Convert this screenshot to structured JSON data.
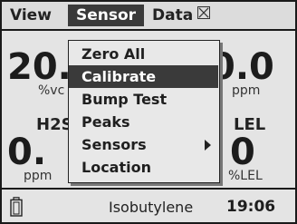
{
  "menubar": {
    "items": [
      "View",
      "Sensor",
      "Data"
    ],
    "close_icon": "close-box-icon"
  },
  "readings": {
    "r1": {
      "value": "20.",
      "unit": "%vc"
    },
    "r2": {
      "value": "0.0",
      "unit": "ppm"
    },
    "r3": {
      "label": "H2S",
      "value": "0.",
      "unit": "ppm"
    },
    "r4": {
      "label": "LEL",
      "value": "0",
      "unit": "%LEL"
    }
  },
  "dropdown": {
    "items": [
      {
        "label": "Zero All"
      },
      {
        "label": "Calibrate",
        "selected": true
      },
      {
        "label": "Bump Test"
      },
      {
        "label": "Peaks"
      },
      {
        "label": "Sensors",
        "submenu": true
      },
      {
        "label": "Location"
      }
    ]
  },
  "status": {
    "battery_icon": "battery-icon",
    "gas": "Isobutylene",
    "time": "19:06"
  }
}
